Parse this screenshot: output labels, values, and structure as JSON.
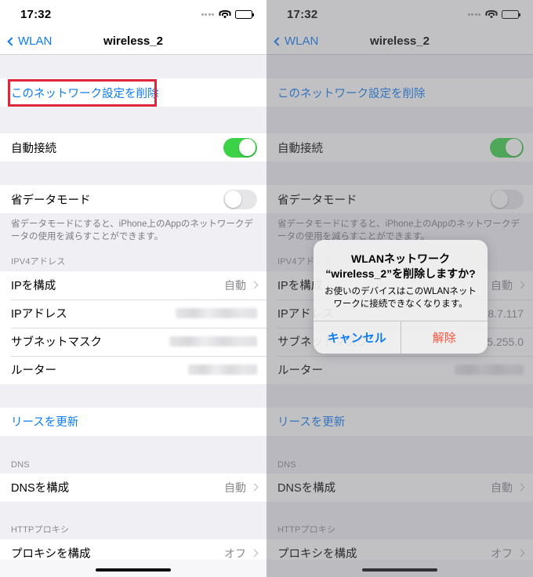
{
  "status_bar": {
    "time": "17:32",
    "signal_icon": "signal-dots-icon",
    "wifi_icon": "wifi-icon",
    "battery_icon": "battery-full-icon"
  },
  "nav": {
    "back_label": "WLAN",
    "back_icon": "chevron-left-icon",
    "title": "wireless_2"
  },
  "settings": {
    "forget_network_label": "このネットワーク設定を削除",
    "auto_join_label": "自動接続",
    "auto_join_state": "on",
    "low_data_label": "省データモード",
    "low_data_state": "off",
    "low_data_footnote": "省データモードにすると、iPhone上のAppのネットワークデータの使用を減らすことができます。",
    "ipv4_header": "IPV4アドレス",
    "configure_ip_label": "IPを構成",
    "configure_ip_value": "自動",
    "ip_address_label": "IPアドレス",
    "ip_address_value_redacted": "",
    "subnet_label": "サブネットマスク",
    "subnet_value_redacted": "",
    "router_label": "ルーター",
    "router_value_redacted": "",
    "renew_lease_label": "リースを更新",
    "dns_header": "DNS",
    "configure_dns_label": "DNSを構成",
    "configure_dns_value": "自動",
    "proxy_header": "HTTPプロキシ",
    "configure_proxy_label": "プロキシを構成",
    "configure_proxy_value": "オフ"
  },
  "right_panel_values": {
    "ip_address_partial": "8.7.117",
    "subnet_partial": "5.255.0"
  },
  "alert": {
    "title_line1": "WLANネットワーク",
    "title_line2": "“wireless_2”を削除しますか?",
    "message": "お使いのデバイスはこのWLANネットワークに接続できなくなります。",
    "cancel_label": "キャンセル",
    "confirm_label": "解除"
  },
  "annotation": {
    "highlight_color": "#e0263a"
  },
  "colors": {
    "accent": "#0b7bf1",
    "toggle_on": "#3cd247",
    "destructive": "#f5523b",
    "group_bg": "#efeff4"
  }
}
